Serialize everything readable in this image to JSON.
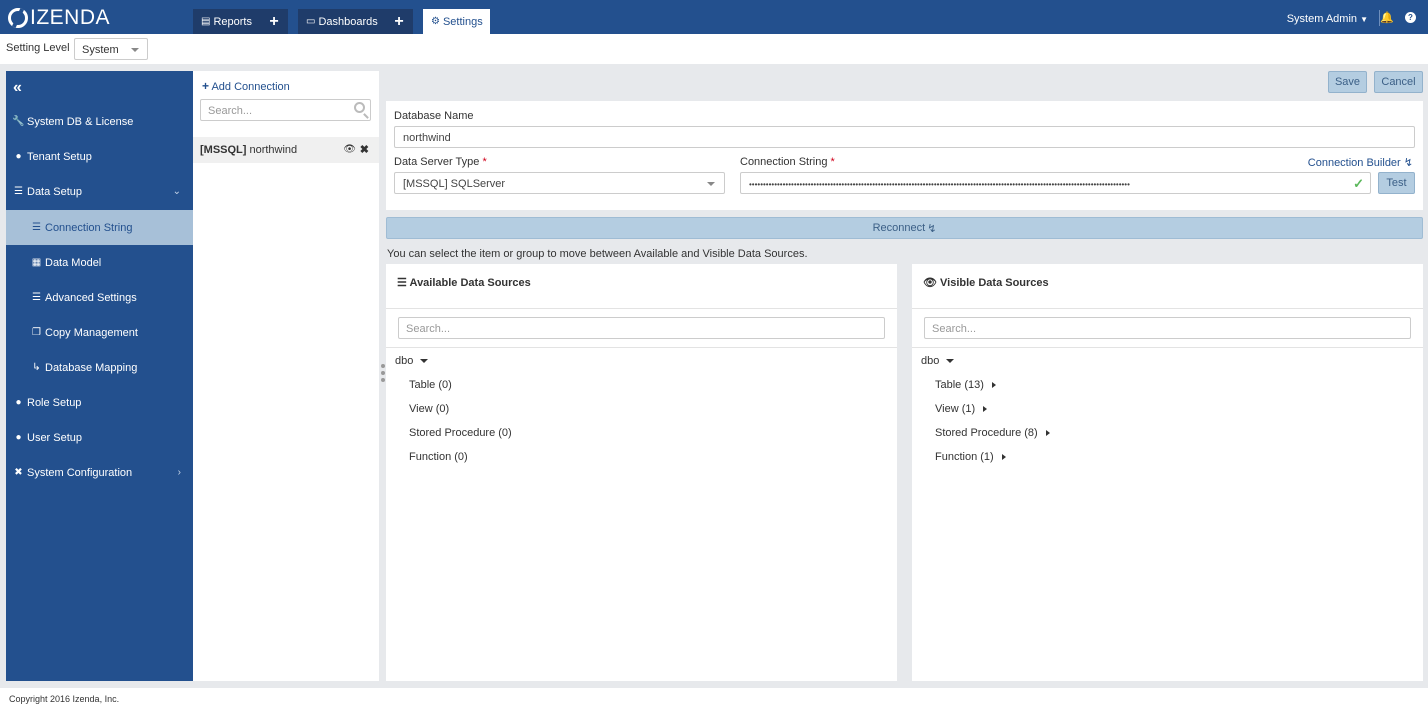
{
  "app": {
    "logo_text": "IZENDA"
  },
  "tabs": [
    {
      "label": "Reports",
      "icon": "list-icon"
    },
    {
      "label": "Dashboards",
      "icon": "monitor-icon"
    },
    {
      "label": "Settings",
      "icon": "gear-icon"
    }
  ],
  "user": {
    "name": "System Admin"
  },
  "setting_level": {
    "label": "Setting Level",
    "value": "System"
  },
  "nav": {
    "items": [
      {
        "label": "System DB & License",
        "icon": "wrench-icon"
      },
      {
        "label": "Tenant Setup",
        "icon": "users-icon"
      },
      {
        "label": "Data Setup",
        "icon": "data-setup-icon"
      },
      {
        "label": "Connection String",
        "icon": "connection-icon"
      },
      {
        "label": "Data Model",
        "icon": "grid-icon"
      },
      {
        "label": "Advanced Settings",
        "icon": "settings-list-icon"
      },
      {
        "label": "Copy Management",
        "icon": "copy-icon"
      },
      {
        "label": "Database Mapping",
        "icon": "mapping-icon"
      },
      {
        "label": "Role Setup",
        "icon": "users-icon"
      },
      {
        "label": "User Setup",
        "icon": "user-icon"
      },
      {
        "label": "System Configuration",
        "icon": "tools-icon"
      }
    ]
  },
  "connections": {
    "add_label": "Add Connection",
    "search_placeholder": "Search...",
    "items": [
      {
        "type": "[MSSQL]",
        "name": "northwind"
      }
    ]
  },
  "toolbar": {
    "save_label": "Save",
    "cancel_label": "Cancel"
  },
  "form": {
    "db_name_label": "Database Name",
    "db_name_value": "northwind",
    "server_type_label": "Data Server Type",
    "server_type_value": "[MSSQL] SQLServer",
    "conn_string_label": "Connection String",
    "conn_string_value": "••••••••••••••••••••••••••••••••••••••••••••••••••••••••••••••••••••••••••••••••••••••••••••••••••••••••••••••••••••••••••••••••••••••••",
    "conn_builder_label": "Connection Builder",
    "test_label": "Test",
    "required_mark": "*"
  },
  "reconnect_label": "Reconnect",
  "hint": "You can select the item or group to move between Available and Visible Data Sources.",
  "available": {
    "title": "Available Data Sources",
    "search_placeholder": "Search...",
    "schema": "dbo",
    "items": [
      "Table (0)",
      "View (0)",
      "Stored Procedure (0)",
      "Function (0)"
    ]
  },
  "visible": {
    "title": "Visible Data Sources",
    "search_placeholder": "Search...",
    "schema": "dbo",
    "items": [
      "Table (13)",
      "View (1)",
      "Stored Procedure (8)",
      "Function (1)"
    ]
  },
  "footer": "Copyright 2016 Izenda, Inc."
}
